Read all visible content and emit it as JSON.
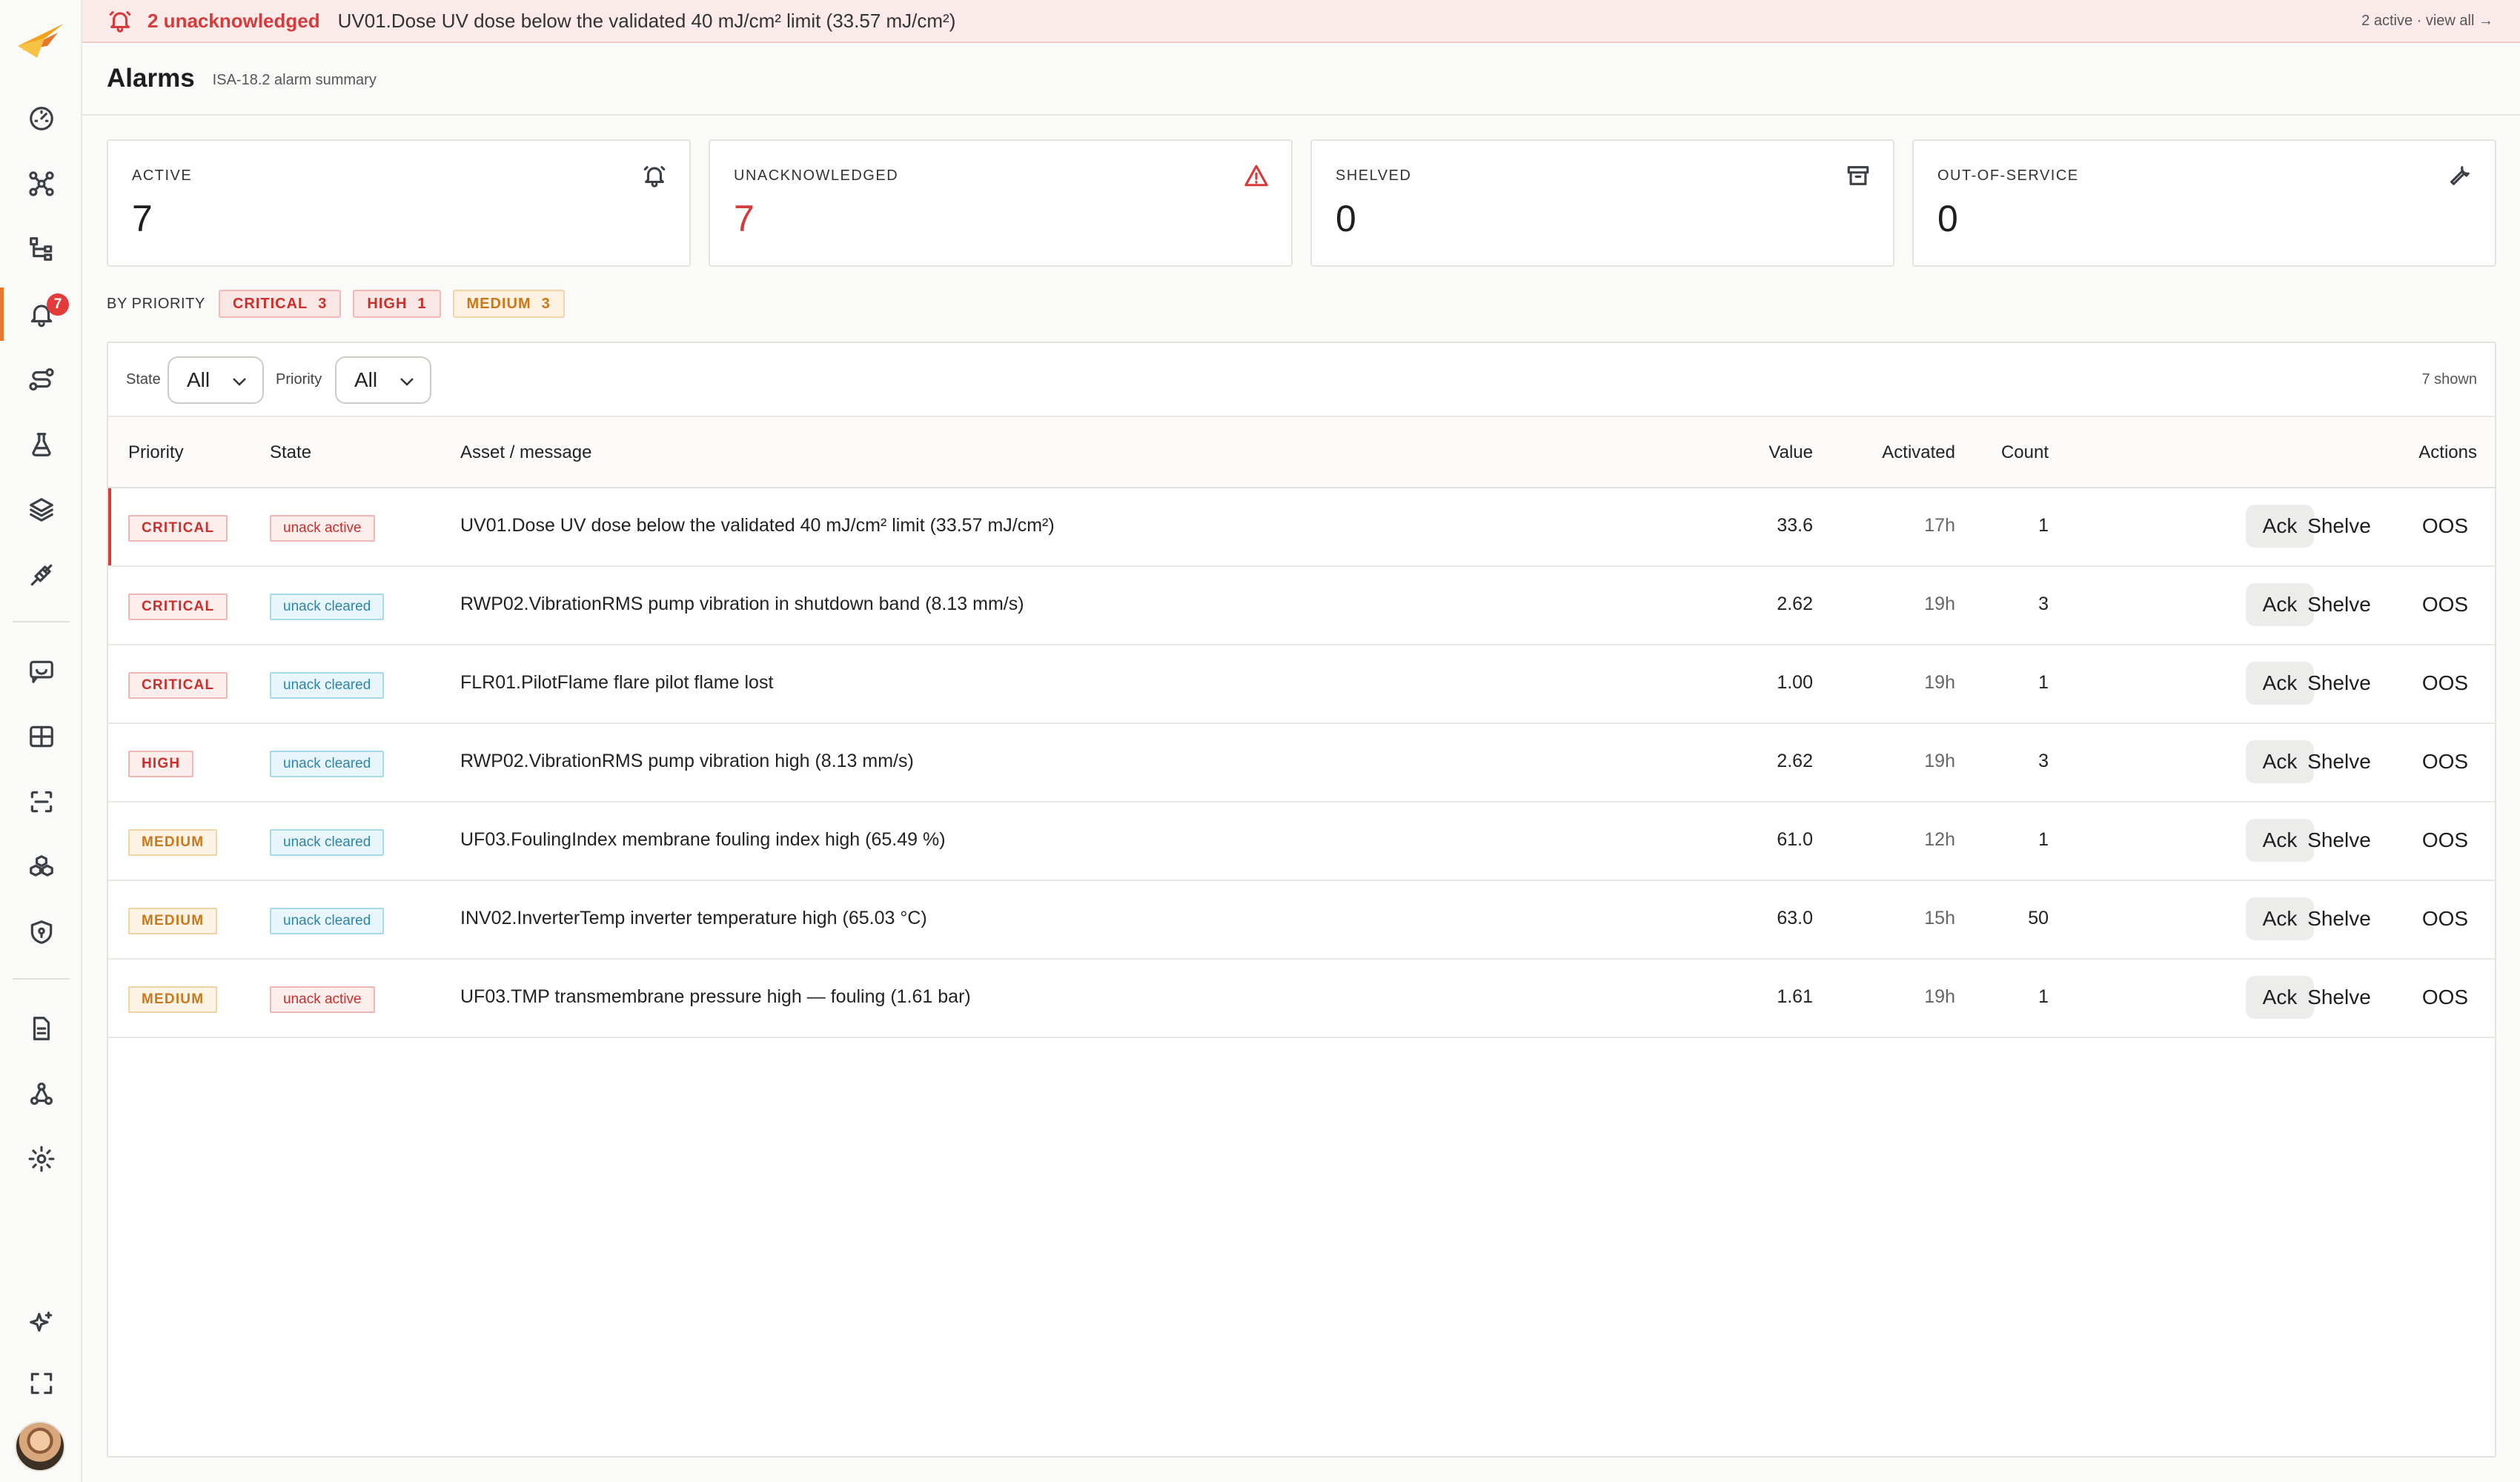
{
  "sidebar": {
    "badge_count": "7",
    "items": [
      {
        "name": "dashboard",
        "icon": "gauge-icon"
      },
      {
        "name": "graph",
        "icon": "nodes-icon"
      },
      {
        "name": "hierarchy",
        "icon": "tree-icon"
      },
      {
        "name": "alarms",
        "icon": "bell-icon",
        "active": true
      },
      {
        "name": "routes",
        "icon": "route-icon"
      },
      {
        "name": "lab",
        "icon": "flask-icon"
      },
      {
        "name": "layers",
        "icon": "layers-icon"
      },
      {
        "name": "connect",
        "icon": "plug-icon"
      },
      {
        "name": "chat",
        "icon": "chat-icon"
      },
      {
        "name": "tables",
        "icon": "table-icon"
      },
      {
        "name": "scan",
        "icon": "scan-icon"
      },
      {
        "name": "models",
        "icon": "cubes-icon"
      },
      {
        "name": "security",
        "icon": "shield-icon"
      },
      {
        "name": "documents",
        "icon": "document-icon"
      },
      {
        "name": "network",
        "icon": "network-icon"
      },
      {
        "name": "settings",
        "icon": "gear-icon"
      },
      {
        "name": "ai",
        "icon": "sparkle-icon"
      },
      {
        "name": "fullscreen",
        "icon": "fullscreen-icon"
      }
    ]
  },
  "banner": {
    "count_text": "2 unacknowledged",
    "message": "UV01.Dose UV dose below the validated 40 mJ/cm² limit (33.57 mJ/cm²)",
    "view_all": "2 active · view all →"
  },
  "header": {
    "title": "Alarms",
    "subtitle": "ISA-18.2 alarm summary"
  },
  "stats": [
    {
      "label": "ACTIVE",
      "value": "7",
      "icon": "bell-icon"
    },
    {
      "label": "UNACKNOWLEDGED",
      "value": "7",
      "icon": "warning-icon",
      "color": "#d63b3b"
    },
    {
      "label": "SHELVED",
      "value": "0",
      "icon": "archive-icon"
    },
    {
      "label": "OUT-OF-SERVICE",
      "value": "0",
      "icon": "wrench-icon"
    }
  ],
  "by_priority": {
    "label": "BY PRIORITY",
    "chips": [
      {
        "label": "CRITICAL",
        "count": "3"
      },
      {
        "label": "HIGH",
        "count": "1"
      },
      {
        "label": "MEDIUM",
        "count": "3"
      }
    ]
  },
  "filters": {
    "state_label": "State",
    "state_value": "All",
    "priority_label": "Priority",
    "priority_value": "All",
    "shown": "7 shown"
  },
  "table": {
    "columns": [
      "Priority",
      "State",
      "Asset / message",
      "Value",
      "Activated",
      "Count",
      "Actions"
    ],
    "actions": {
      "ack": "Ack",
      "shelve": "Shelve",
      "oos": "OOS"
    },
    "rows": [
      {
        "priority": "CRITICAL",
        "state": "unack active",
        "message": "UV01.Dose UV dose below the validated 40 mJ/cm² limit (33.57 mJ/cm²)",
        "value": "33.6",
        "activated": "17h",
        "count": "1"
      },
      {
        "priority": "CRITICAL",
        "state": "unack cleared",
        "message": "RWP02.VibrationRMS pump vibration in shutdown band (8.13 mm/s)",
        "value": "2.62",
        "activated": "19h",
        "count": "3"
      },
      {
        "priority": "CRITICAL",
        "state": "unack cleared",
        "message": "FLR01.PilotFlame flare pilot flame lost",
        "value": "1.00",
        "activated": "19h",
        "count": "1"
      },
      {
        "priority": "HIGH",
        "state": "unack cleared",
        "message": "RWP02.VibrationRMS pump vibration high (8.13 mm/s)",
        "value": "2.62",
        "activated": "19h",
        "count": "3"
      },
      {
        "priority": "MEDIUM",
        "state": "unack cleared",
        "message": "UF03.FoulingIndex membrane fouling index high (65.49 %)",
        "value": "61.0",
        "activated": "12h",
        "count": "1"
      },
      {
        "priority": "MEDIUM",
        "state": "unack cleared",
        "message": "INV02.InverterTemp inverter temperature high (65.03 °C)",
        "value": "63.0",
        "activated": "15h",
        "count": "50"
      },
      {
        "priority": "MEDIUM",
        "state": "unack active",
        "message": "UF03.TMP transmembrane pressure high — fouling (1.61 bar)",
        "value": "1.61",
        "activated": "19h",
        "count": "1"
      }
    ]
  }
}
